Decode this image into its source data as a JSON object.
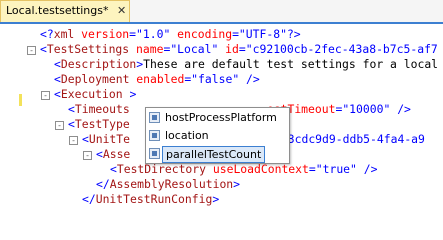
{
  "tab": {
    "title": "Local.testsettings*",
    "close_glyph": "✕"
  },
  "lines": [
    {
      "indent": 0,
      "fold": "",
      "tokens": [
        {
          "t": "<?",
          "c": "tk-pi"
        },
        {
          "t": "xml",
          "c": "tk-tag"
        },
        {
          "t": " version",
          "c": "tk-attr"
        },
        {
          "t": "=",
          "c": "tk-punct"
        },
        {
          "t": "\"1.0\"",
          "c": "tk-val"
        },
        {
          "t": " encoding",
          "c": "tk-attr"
        },
        {
          "t": "=",
          "c": "tk-punct"
        },
        {
          "t": "\"UTF-8\"",
          "c": "tk-val"
        },
        {
          "t": "?>",
          "c": "tk-pi"
        }
      ]
    },
    {
      "indent": 0,
      "fold": "-",
      "tokens": [
        {
          "t": "<",
          "c": "tk-punct"
        },
        {
          "t": "TestSettings",
          "c": "tk-tag"
        },
        {
          "t": " name",
          "c": "tk-attr"
        },
        {
          "t": "=",
          "c": "tk-punct"
        },
        {
          "t": "\"Local\"",
          "c": "tk-val"
        },
        {
          "t": " id",
          "c": "tk-attr"
        },
        {
          "t": "=",
          "c": "tk-punct"
        },
        {
          "t": "\"c92100cb-2fec-43a8-b7c5-af7",
          "c": "tk-val"
        }
      ]
    },
    {
      "indent": 1,
      "fold": "",
      "tokens": [
        {
          "t": "<",
          "c": "tk-punct"
        },
        {
          "t": "Description",
          "c": "tk-tag"
        },
        {
          "t": ">",
          "c": "tk-punct"
        },
        {
          "t": "These are default test settings for a local",
          "c": "tk-text"
        }
      ]
    },
    {
      "indent": 1,
      "fold": "",
      "tokens": [
        {
          "t": "<",
          "c": "tk-punct"
        },
        {
          "t": "Deployment",
          "c": "tk-tag"
        },
        {
          "t": " enabled",
          "c": "tk-attr"
        },
        {
          "t": "=",
          "c": "tk-punct"
        },
        {
          "t": "\"false\"",
          "c": "tk-val"
        },
        {
          "t": " />",
          "c": "tk-punct"
        }
      ]
    },
    {
      "indent": 1,
      "fold": "-",
      "tokens": [
        {
          "t": "<",
          "c": "tk-punct"
        },
        {
          "t": "Execution",
          "c": "tk-tag"
        },
        {
          "t": " >",
          "c": "tk-punct"
        }
      ]
    },
    {
      "indent": 2,
      "fold": "",
      "tokens": [
        {
          "t": "<",
          "c": "tk-punct"
        },
        {
          "t": "Timeouts",
          "c": "tk-tag"
        },
        {
          "t": "                    ",
          "c": "tk-text"
        },
        {
          "t": "estTimeout",
          "c": "tk-attr"
        },
        {
          "t": "=",
          "c": "tk-punct"
        },
        {
          "t": "\"10000\"",
          "c": "tk-val"
        },
        {
          "t": " />",
          "c": "tk-punct"
        }
      ]
    },
    {
      "indent": 2,
      "fold": "-",
      "tokens": [
        {
          "t": "<",
          "c": "tk-punct"
        },
        {
          "t": "TestType",
          "c": "tk-tag"
        }
      ]
    },
    {
      "indent": 3,
      "fold": "-",
      "tokens": [
        {
          "t": "<",
          "c": "tk-punct"
        },
        {
          "t": "UnitTe",
          "c": "tk-tag"
        },
        {
          "t": "                     ",
          "c": "tk-text"
        },
        {
          "t": "\"13cdc9d9-ddb5-4fa4-a9",
          "c": "tk-val"
        }
      ]
    },
    {
      "indent": 4,
      "fold": "-",
      "tokens": [
        {
          "t": "<",
          "c": "tk-punct"
        },
        {
          "t": "Asse",
          "c": "tk-tag"
        }
      ]
    },
    {
      "indent": 5,
      "fold": "",
      "tokens": [
        {
          "t": "<",
          "c": "tk-punct"
        },
        {
          "t": "TestDirectory",
          "c": "tk-tag"
        },
        {
          "t": " useLoadContext",
          "c": "tk-attr"
        },
        {
          "t": "=",
          "c": "tk-punct"
        },
        {
          "t": "\"true\"",
          "c": "tk-val"
        },
        {
          "t": " />",
          "c": "tk-punct"
        }
      ]
    },
    {
      "indent": 4,
      "fold": "",
      "tokens": [
        {
          "t": "</",
          "c": "tk-punct"
        },
        {
          "t": "AssemblyResolution",
          "c": "tk-tag"
        },
        {
          "t": ">",
          "c": "tk-punct"
        }
      ]
    },
    {
      "indent": 3,
      "fold": "",
      "tokens": [
        {
          "t": "</",
          "c": "tk-punct"
        },
        {
          "t": "UnitTestRunConfig",
          "c": "tk-tag"
        },
        {
          "t": ">",
          "c": "tk-punct"
        }
      ]
    }
  ],
  "completion": {
    "items": [
      {
        "label": "hostProcessPlatform",
        "selected": false
      },
      {
        "label": "location",
        "selected": false
      },
      {
        "label": "parallelTestCount",
        "selected": true
      }
    ]
  },
  "colors": {
    "tag": "#a31515",
    "attr": "#ff0000",
    "value": "#0000ff",
    "punct": "#0000ff",
    "accent": "#3c7fd1",
    "tab_bg": "#fdf4bf"
  }
}
